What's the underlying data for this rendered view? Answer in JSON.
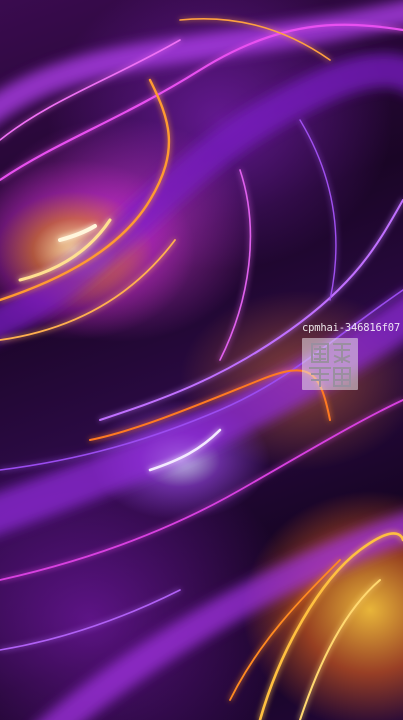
{
  "image": {
    "kind": "abstract swirling light art",
    "palette": {
      "background": "#1a0526",
      "purple": "#9b2fe0",
      "magenta": "#e040e8",
      "orange": "#ff8a20",
      "gold": "#ffd060",
      "white_glow": "#f4eaff"
    }
  },
  "watermark": {
    "code": "cpmhai-346816f07",
    "seal_icon": "stamp-seal-icon",
    "seal_glyphs": "图录"
  }
}
